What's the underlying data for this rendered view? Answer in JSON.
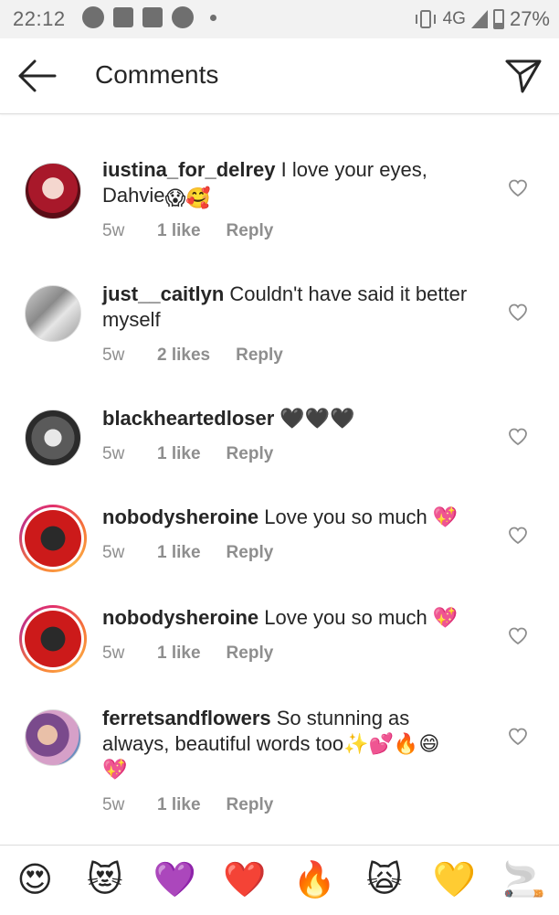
{
  "status_bar": {
    "time": "22:12",
    "network": "4G",
    "battery": "27%"
  },
  "header": {
    "title": "Comments",
    "back_icon": "arrow-left-icon",
    "send_icon": "paper-plane-icon"
  },
  "comments": [
    {
      "username": "iustina_for_delrey",
      "text_line1": " I love your eyes,",
      "text_line2": "Dahvie",
      "emojis": "😱🥰",
      "age": "5w",
      "likes": "1 like",
      "reply": "Reply"
    },
    {
      "username": "just__caitlyn",
      "text_line1": " Couldn't have said it better",
      "text_line2": "myself",
      "emojis": "",
      "age": "5w",
      "likes": "2 likes",
      "reply": "Reply"
    },
    {
      "username": "blackheartedloser",
      "text_line1": " 🖤🖤🖤",
      "text_line2": "",
      "emojis": "",
      "age": "5w",
      "likes": "1 like",
      "reply": "Reply"
    },
    {
      "username": "nobodysheroine",
      "text_line1": " Love you so much 💖",
      "text_line2": "",
      "emojis": "",
      "age": "5w",
      "likes": "1 like",
      "reply": "Reply"
    },
    {
      "username": "nobodysheroine",
      "text_line1": " Love you so much 💖",
      "text_line2": "",
      "emojis": "",
      "age": "5w",
      "likes": "1 like",
      "reply": "Reply"
    },
    {
      "username": "ferretsandflowers",
      "text_line1": " So stunning as",
      "text_line2": "always, beautiful words too✨💕🔥😄",
      "text_line3": "💖",
      "emojis": "",
      "age": "5w",
      "likes": "1 like",
      "reply": "Reply"
    }
  ],
  "emoji_bar": [
    "😍",
    "😻",
    "💜",
    "❤️",
    "🔥",
    "🙀",
    "💛",
    "🚬"
  ],
  "colors": {
    "text": "#262626",
    "meta": "#8e8e8e",
    "story_ring_start": "#e1306c",
    "story_ring_end": "#fcaf45"
  }
}
